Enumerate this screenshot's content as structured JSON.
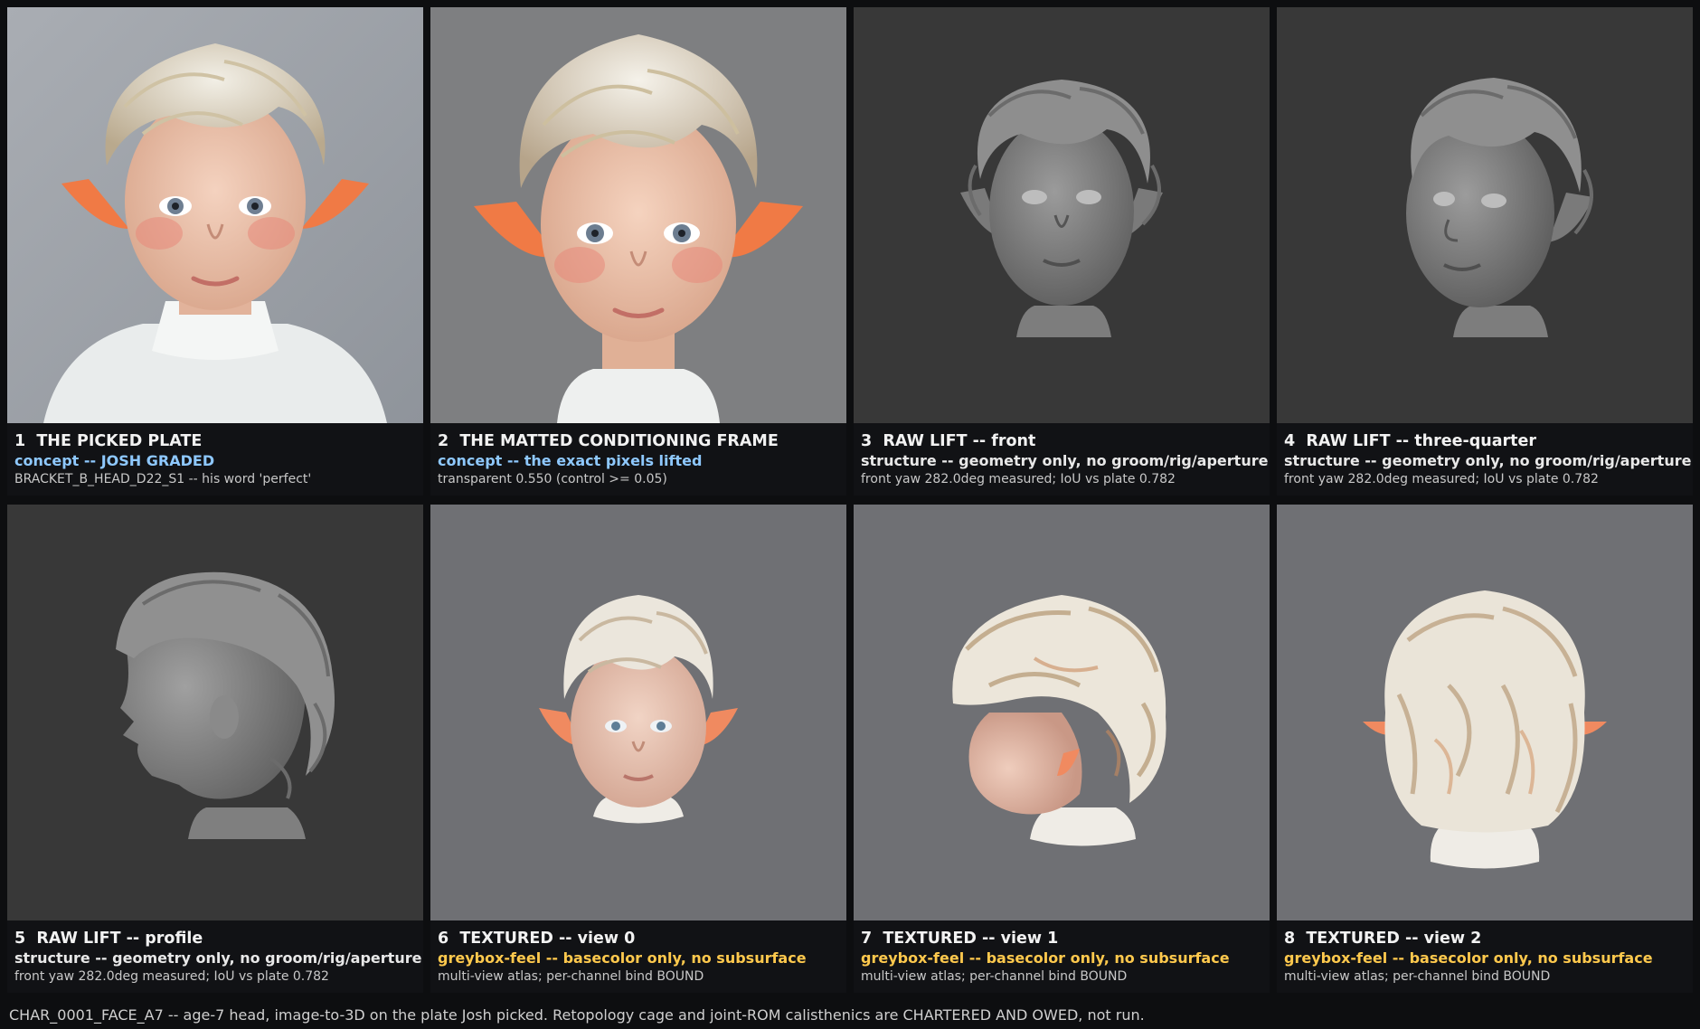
{
  "palette": {
    "concept": "#8ec8ff",
    "structure": "#e8e8e8",
    "greybox": "#ffc94d"
  },
  "panels": [
    {
      "num": "1",
      "title": "THE PICKED PLATE",
      "line2": "concept -- JOSH GRADED",
      "line2_kind": "concept",
      "line3": "BRACKET_B_HEAD_D22_S1 -- his word 'perfect'",
      "image": "picked-plate-render"
    },
    {
      "num": "2",
      "title": "THE MATTED CONDITIONING FRAME",
      "line2": "concept -- the exact pixels lifted",
      "line2_kind": "concept",
      "line3": "transparent 0.550 (control >= 0.05)",
      "image": "matted-frame-render"
    },
    {
      "num": "3",
      "title": "RAW LIFT -- front",
      "line2": "structure -- geometry only, no groom/rig/aperture",
      "line2_kind": "structure",
      "line3": "front yaw 282.0deg measured; IoU vs plate 0.782",
      "image": "raw-lift-front-render"
    },
    {
      "num": "4",
      "title": "RAW LIFT -- three-quarter",
      "line2": "structure -- geometry only, no groom/rig/aperture",
      "line2_kind": "structure",
      "line3": "front yaw 282.0deg measured; IoU vs plate 0.782",
      "image": "raw-lift-three-quarter-render"
    },
    {
      "num": "5",
      "title": "RAW LIFT -- profile",
      "line2": "structure -- geometry only, no groom/rig/aperture",
      "line2_kind": "structure",
      "line3": "front yaw 282.0deg measured; IoU vs plate 0.782",
      "image": "raw-lift-profile-render"
    },
    {
      "num": "6",
      "title": "TEXTURED -- view 0",
      "line2": "greybox-feel -- basecolor only, no subsurface",
      "line2_kind": "greybox",
      "line3": "multi-view atlas; per-channel bind BOUND",
      "image": "textured-view-0-render"
    },
    {
      "num": "7",
      "title": "TEXTURED -- view 1",
      "line2": "greybox-feel -- basecolor only, no subsurface",
      "line2_kind": "greybox",
      "line3": "multi-view atlas; per-channel bind BOUND",
      "image": "textured-view-1-render"
    },
    {
      "num": "8",
      "title": "TEXTURED -- view 2",
      "line2": "greybox-feel -- basecolor only, no subsurface",
      "line2_kind": "greybox",
      "line3": "multi-view atlas; per-channel bind BOUND",
      "image": "textured-view-2-render"
    }
  ],
  "footer": "CHAR_0001_FACE_A7 -- age-7 head, image-to-3D on the plate Josh picked. Retopology cage and joint-ROM calisthenics are CHARTERED AND OWED, not run."
}
